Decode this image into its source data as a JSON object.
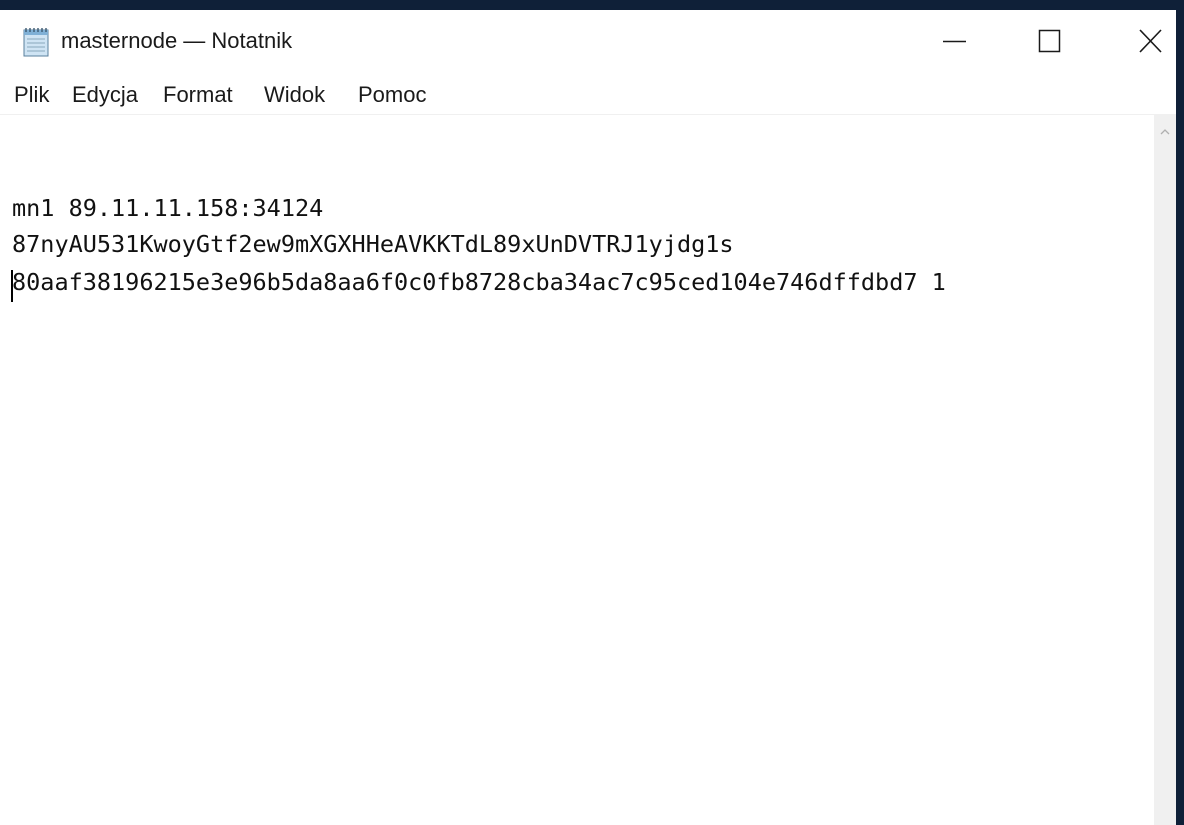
{
  "window": {
    "title": "masternode — Notatnik"
  },
  "icons": {
    "app": "notepad-icon",
    "minimize": "minimize-icon",
    "maximize": "maximize-icon",
    "close": "close-icon",
    "scroll_up": "chevron-up-icon"
  },
  "menu": {
    "items": [
      "Plik",
      "Edycja",
      "Format",
      "Widok",
      "Pomoc"
    ]
  },
  "document": {
    "lines": [
      "mn1 89.11.11.158:34124",
      "87nyAU531KwoyGtf2ew9mXGXHHeAVKKTdL89xUnDVTRJ1yjdg1s",
      "80aaf38196215e3e96b5da8aa6f0c0fb8728cba34ac7c95ced104e746dffdbd7 1"
    ]
  },
  "colors": {
    "desktop_background": "#0f2038",
    "window_background": "#ffffff",
    "text": "#111111"
  }
}
